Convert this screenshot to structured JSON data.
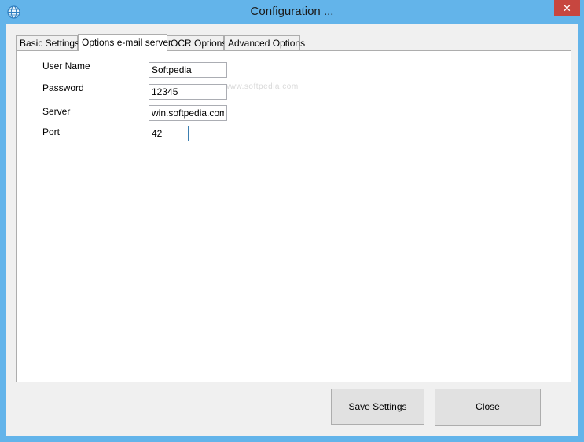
{
  "window": {
    "title": "Configuration ...",
    "close_glyph": "✕",
    "app_icon": "globe-icon",
    "accent_color": "#63b4ea",
    "close_color": "#c7463f"
  },
  "tabs": [
    {
      "label": "Basic Settings",
      "active": false
    },
    {
      "label": "Options e-mail server",
      "active": true
    },
    {
      "label": "OCR Options",
      "active": false
    },
    {
      "label": "Advanced Options",
      "active": false
    }
  ],
  "watermark": "www.softpedia.com",
  "form": {
    "user_name": {
      "label": "User Name",
      "value": "Softpedia"
    },
    "password": {
      "label": "Password",
      "value": "12345"
    },
    "server": {
      "label": "Server",
      "value": "win.softpedia.com"
    },
    "port": {
      "label": "Port",
      "value": "42"
    }
  },
  "buttons": {
    "save": "Save Settings",
    "close": "Close"
  }
}
